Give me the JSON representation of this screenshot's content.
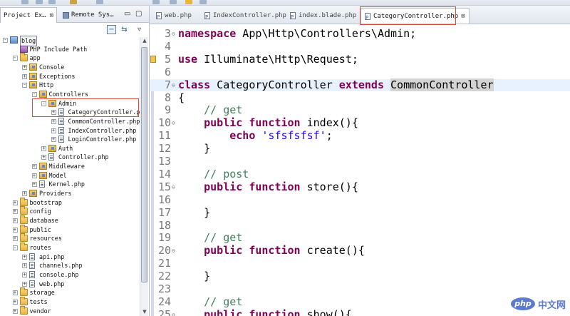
{
  "left_tabs": [
    {
      "label": "Project Ex…",
      "active": true
    },
    {
      "label": "Remote Sys…",
      "active": false
    }
  ],
  "tree": [
    {
      "label": "blog",
      "depth": 0,
      "icon": "project-icon",
      "twisty": "-",
      "boxed": true
    },
    {
      "label": "PHP Include Path",
      "depth": 1,
      "icon": "library-icon",
      "twisty": ""
    },
    {
      "label": "app",
      "depth": 1,
      "icon": "folder-icon",
      "twisty": "-"
    },
    {
      "label": "Console",
      "depth": 2,
      "icon": "package-icon",
      "twisty": "+"
    },
    {
      "label": "Exceptions",
      "depth": 2,
      "icon": "package-icon",
      "twisty": "+"
    },
    {
      "label": "Http",
      "depth": 2,
      "icon": "package-icon",
      "twisty": "-"
    },
    {
      "label": "Controllers",
      "depth": 3,
      "icon": "package-icon",
      "twisty": "-"
    },
    {
      "label": "Admin",
      "depth": 4,
      "icon": "package-icon",
      "twisty": "-"
    },
    {
      "label": "CategoryController.php",
      "depth": 5,
      "icon": "php-file-icon",
      "twisty": "+"
    },
    {
      "label": "CommonController.php",
      "depth": 5,
      "icon": "php-file-icon",
      "twisty": "+"
    },
    {
      "label": "IndexController.php",
      "depth": 5,
      "icon": "php-file-icon",
      "twisty": "+"
    },
    {
      "label": "LoginController.php",
      "depth": 5,
      "icon": "php-file-icon",
      "twisty": "+"
    },
    {
      "label": "Auth",
      "depth": 4,
      "icon": "package-icon",
      "twisty": "+"
    },
    {
      "label": "Controller.php",
      "depth": 4,
      "icon": "php-file-icon",
      "twisty": "+"
    },
    {
      "label": "Middleware",
      "depth": 3,
      "icon": "package-icon",
      "twisty": "+"
    },
    {
      "label": "Model",
      "depth": 3,
      "icon": "package-icon",
      "twisty": "+"
    },
    {
      "label": "Kernel.php",
      "depth": 3,
      "icon": "php-file-icon",
      "twisty": "+"
    },
    {
      "label": "Providers",
      "depth": 2,
      "icon": "package-icon",
      "twisty": "+"
    },
    {
      "label": "bootstrap",
      "depth": 1,
      "icon": "folder-icon",
      "twisty": "+"
    },
    {
      "label": "config",
      "depth": 1,
      "icon": "folder-icon",
      "twisty": "+"
    },
    {
      "label": "database",
      "depth": 1,
      "icon": "folder-icon",
      "twisty": "+"
    },
    {
      "label": "public",
      "depth": 1,
      "icon": "folder-icon",
      "twisty": "+"
    },
    {
      "label": "resources",
      "depth": 1,
      "icon": "folder-icon",
      "twisty": "+"
    },
    {
      "label": "routes",
      "depth": 1,
      "icon": "folder-icon",
      "twisty": "-"
    },
    {
      "label": "api.php",
      "depth": 2,
      "icon": "php-file-icon",
      "twisty": "+"
    },
    {
      "label": "channels.php",
      "depth": 2,
      "icon": "php-file-icon",
      "twisty": "+"
    },
    {
      "label": "console.php",
      "depth": 2,
      "icon": "php-file-icon",
      "twisty": "+"
    },
    {
      "label": "web.php",
      "depth": 2,
      "icon": "php-file-icon",
      "twisty": "+"
    },
    {
      "label": "storage",
      "depth": 1,
      "icon": "folder-icon",
      "twisty": "+"
    },
    {
      "label": "tests",
      "depth": 1,
      "icon": "folder-icon",
      "twisty": "+"
    },
    {
      "label": "vendor",
      "depth": 1,
      "icon": "folder-icon",
      "twisty": "+"
    }
  ],
  "editor_tabs": [
    {
      "label": "web.php",
      "active": false
    },
    {
      "label": "IndexController.php",
      "active": false
    },
    {
      "label": "index.blade.php",
      "active": false
    },
    {
      "label": "CategoryController.php",
      "active": true
    }
  ],
  "code_lines": [
    {
      "n": "3",
      "fold": "⊖",
      "tokens": [
        [
          "kw",
          "namespace"
        ],
        [
          "t",
          " App\\Http\\Controllers\\Admin;"
        ]
      ]
    },
    {
      "n": "4",
      "tokens": []
    },
    {
      "n": "5",
      "marker": true,
      "tokens": [
        [
          "kw",
          "use"
        ],
        [
          "t",
          " Illuminate\\Http\\Request;"
        ]
      ]
    },
    {
      "n": "6",
      "tokens": []
    },
    {
      "n": "7",
      "fold": "⊖",
      "current": true,
      "tokens": [
        [
          "kw",
          "class"
        ],
        [
          "t",
          " CategoryController "
        ],
        [
          "kw",
          "extends"
        ],
        [
          "t",
          " "
        ],
        [
          "hl",
          "CommonController"
        ]
      ]
    },
    {
      "n": "8",
      "tokens": [
        [
          "t",
          "{"
        ]
      ]
    },
    {
      "n": "9",
      "tokens": [
        [
          "t",
          "    "
        ],
        [
          "cm",
          "// get"
        ]
      ]
    },
    {
      "n": "10",
      "fold": "⊖",
      "tokens": [
        [
          "t",
          "    "
        ],
        [
          "kw",
          "public"
        ],
        [
          "t",
          " "
        ],
        [
          "kw",
          "function"
        ],
        [
          "t",
          " index(){"
        ]
      ]
    },
    {
      "n": "11",
      "tokens": [
        [
          "t",
          "        "
        ],
        [
          "kw",
          "echo"
        ],
        [
          "t",
          " "
        ],
        [
          "str",
          "'sfsfsfsf'"
        ],
        [
          "t",
          ";"
        ]
      ]
    },
    {
      "n": "12",
      "tokens": [
        [
          "t",
          "    }"
        ]
      ]
    },
    {
      "n": "13",
      "tokens": []
    },
    {
      "n": "14",
      "tokens": [
        [
          "t",
          "    "
        ],
        [
          "cm",
          "// post"
        ]
      ]
    },
    {
      "n": "15",
      "fold": "⊖",
      "tokens": [
        [
          "t",
          "    "
        ],
        [
          "kw",
          "public"
        ],
        [
          "t",
          " "
        ],
        [
          "kw",
          "function"
        ],
        [
          "t",
          " store(){"
        ]
      ]
    },
    {
      "n": "16",
      "tokens": []
    },
    {
      "n": "17",
      "tokens": [
        [
          "t",
          "    }"
        ]
      ]
    },
    {
      "n": "18",
      "tokens": []
    },
    {
      "n": "19",
      "tokens": [
        [
          "t",
          "    "
        ],
        [
          "cm",
          "// get"
        ]
      ]
    },
    {
      "n": "20",
      "fold": "⊖",
      "tokens": [
        [
          "t",
          "    "
        ],
        [
          "kw",
          "public"
        ],
        [
          "t",
          " "
        ],
        [
          "kw",
          "function"
        ],
        [
          "t",
          " create(){"
        ]
      ]
    },
    {
      "n": "21",
      "tokens": []
    },
    {
      "n": "22",
      "tokens": [
        [
          "t",
          "    }"
        ]
      ]
    },
    {
      "n": "23",
      "tokens": []
    },
    {
      "n": "24",
      "tokens": [
        [
          "t",
          "    "
        ],
        [
          "cm",
          "// get"
        ]
      ]
    },
    {
      "n": "25",
      "fold": "⊖",
      "tokens": [
        [
          "t",
          "    "
        ],
        [
          "kw",
          "public"
        ],
        [
          "t",
          " "
        ],
        [
          "kw",
          "function"
        ],
        [
          "t",
          " show(){"
        ]
      ]
    }
  ],
  "watermark": {
    "logo": "php",
    "text": "中文网"
  },
  "colors": {
    "keyword": "#7f0055",
    "comment": "#3f7f5f",
    "string": "#2a00ff",
    "highlight": "#e0493c",
    "current_line": "#e8f2fe"
  }
}
